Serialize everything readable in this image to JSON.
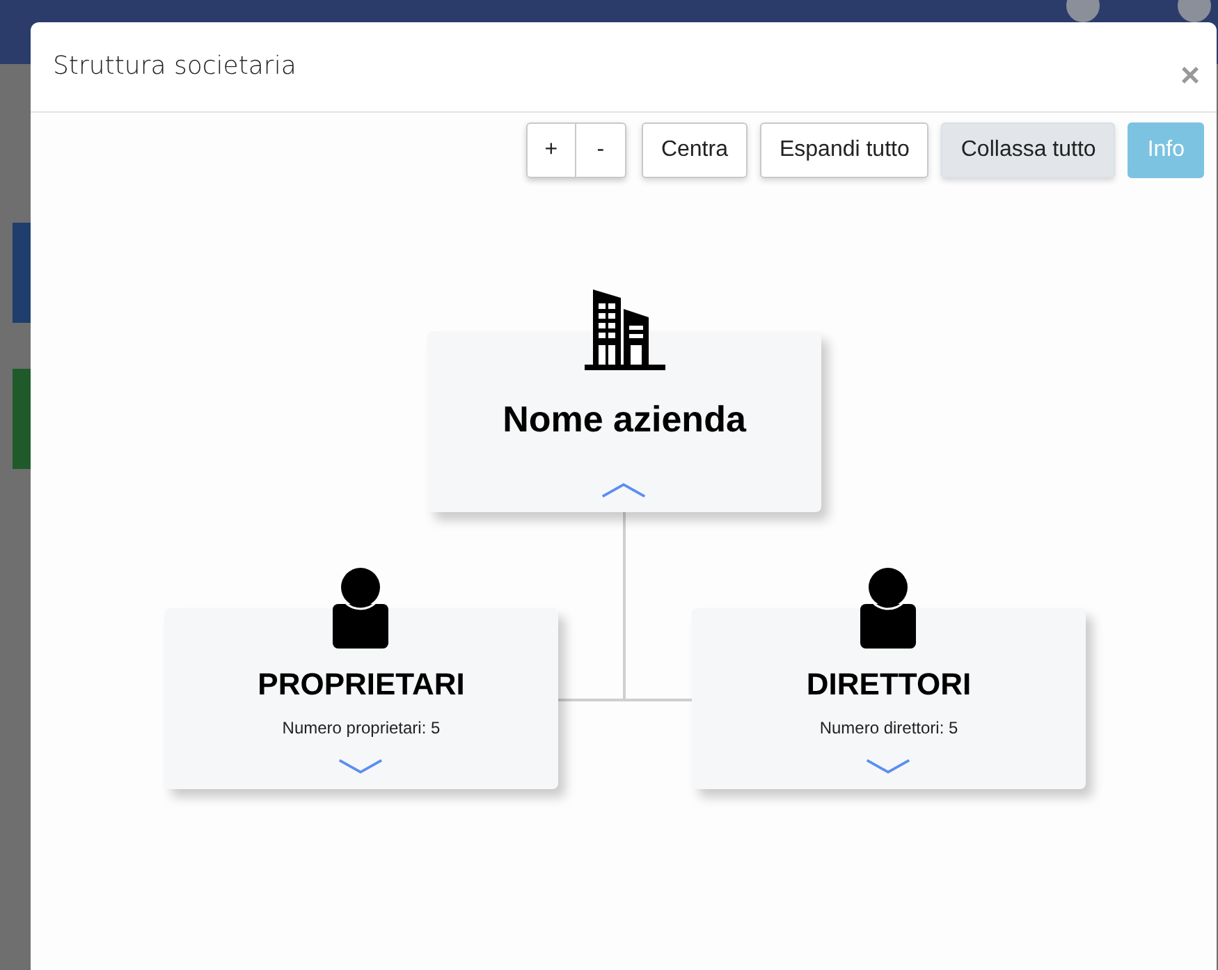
{
  "modal": {
    "title": "Struttura societaria",
    "close": "×"
  },
  "toolbar": {
    "zoom_buttons": [
      {
        "label": "+"
      },
      {
        "label": "-"
      }
    ],
    "buttons": [
      {
        "label": "Centra",
        "kind": "default"
      },
      {
        "label": "Espandi tutto",
        "kind": "default"
      },
      {
        "label": "Collassa tutto",
        "kind": "active"
      },
      {
        "label": "Info",
        "kind": "info"
      }
    ]
  },
  "root": {
    "title": "Nome azienda",
    "kind": "company",
    "expanded": true
  },
  "children": [
    {
      "title": "PROPRIETARI",
      "subtitle": "Numero proprietari: 5",
      "kind": "group",
      "expanded": false
    },
    {
      "title": "DIRETTORI",
      "subtitle": "Numero direttori: 5",
      "kind": "group",
      "expanded": false
    }
  ]
}
